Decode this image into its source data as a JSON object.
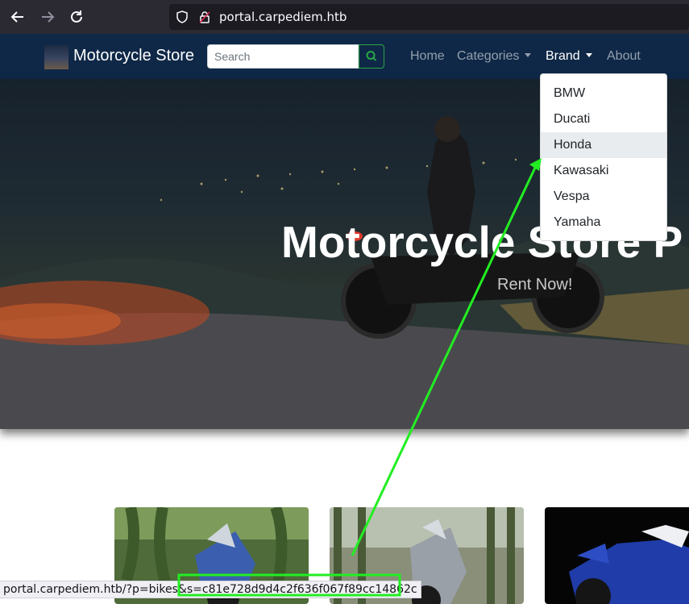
{
  "browser": {
    "url": "portal.carpediem.htb",
    "status_url": "portal.carpediem.htb/?p=bikes&s=c81e728d9d4c2f636f067f89cc14862c"
  },
  "navbar": {
    "brand": "Motorcycle Store",
    "search_placeholder": "Search",
    "links": {
      "home": "Home",
      "categories": "Categories",
      "brand": "Brand",
      "about": "About"
    }
  },
  "brand_dropdown": {
    "items": [
      "BMW",
      "Ducati",
      "Honda",
      "Kawasaki",
      "Vespa",
      "Yamaha"
    ],
    "highlighted": "Honda"
  },
  "hero": {
    "title": "Motorcycle Store P",
    "subtitle": "Rent Now!"
  },
  "colors": {
    "navbar_bg": "#0f2847",
    "search_accent": "#28a745",
    "annotation": "#22ee22"
  },
  "icons": [
    "back-arrow-icon",
    "forward-arrow-icon",
    "reload-icon",
    "shield-icon",
    "lock-icon",
    "search-icon"
  ]
}
